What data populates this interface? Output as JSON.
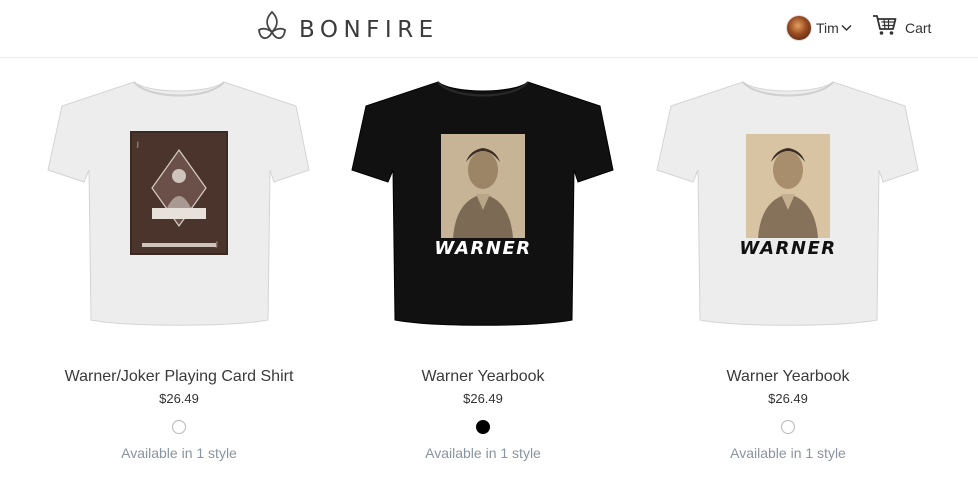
{
  "header": {
    "brand": "BONFIRE",
    "user_name": "Tim",
    "cart_label": "Cart"
  },
  "icons": {
    "logo": "flame-leaf-icon",
    "user_menu": "chevron-down-icon",
    "cart": "shopping-cart-icon"
  },
  "colors": {
    "text": "#333333",
    "muted": "#8a94a0",
    "shirt_white": "#ededed",
    "shirt_black": "#111111"
  },
  "products": [
    {
      "title": "Warner/Joker Playing Card Shirt",
      "price": "$26.49",
      "style_color": "#ffffff",
      "availability": "Available in 1 style"
    },
    {
      "title": "Warner Yearbook",
      "price": "$26.49",
      "style_color": "#000000",
      "availability": "Available in 1 style",
      "print_text": "WARNER"
    },
    {
      "title": "Warner Yearbook",
      "price": "$26.49",
      "style_color": "#ffffff",
      "availability": "Available in 1 style",
      "print_text": "WARNER"
    }
  ]
}
